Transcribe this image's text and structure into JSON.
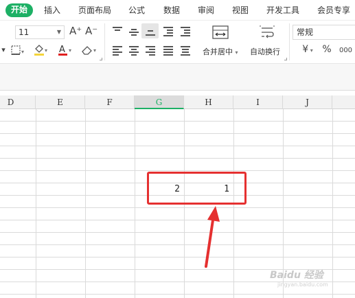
{
  "menu": {
    "tabs": [
      "开始",
      "插入",
      "页面布局",
      "公式",
      "数据",
      "审阅",
      "视图",
      "开发工具",
      "会员专享"
    ]
  },
  "ribbon": {
    "font_size": "11",
    "grow_font_glyph": "A⁺",
    "shrink_font_glyph": "A⁻",
    "merge_label": "合并居中",
    "wrap_label": "自动换行",
    "number_format": "常规",
    "currency_glyph": "¥",
    "percent_glyph": "%",
    "thousands_glyph": "000"
  },
  "grid": {
    "columns": [
      {
        "label": "D",
        "selected": false
      },
      {
        "label": "E",
        "selected": false
      },
      {
        "label": "F",
        "selected": false
      },
      {
        "label": "G",
        "selected": true
      },
      {
        "label": "H",
        "selected": false
      },
      {
        "label": "I",
        "selected": false
      },
      {
        "label": "J",
        "selected": false
      }
    ],
    "cells": [
      {
        "column": "G",
        "value": "2"
      },
      {
        "column": "H",
        "value": "1"
      }
    ]
  },
  "annotation": {
    "box_color": "#e53030",
    "arrow_color": "#e53030"
  },
  "colors": {
    "accent": "#1db065",
    "selected_header_bg": "#dcdcdc"
  },
  "watermark": {
    "text": "Baidu 经验",
    "sub": "jingyan.baidu.com"
  }
}
